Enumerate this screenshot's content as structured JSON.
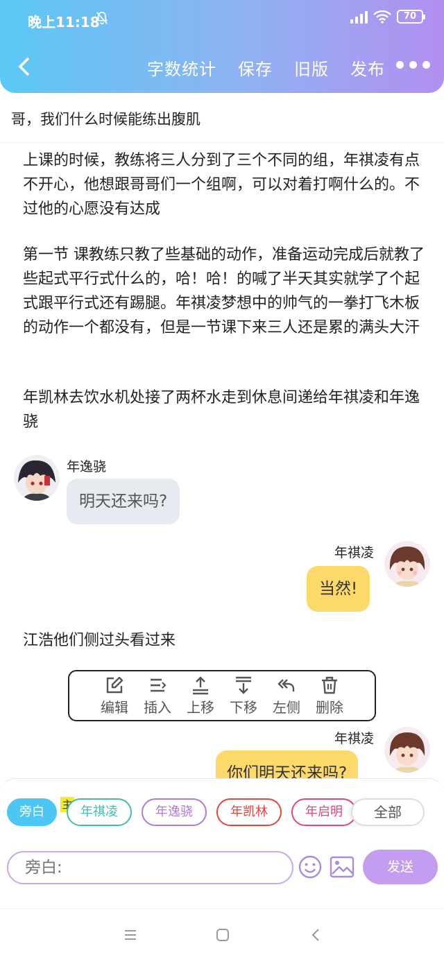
{
  "status_bar": {
    "time": "晚上11:18",
    "battery": "70"
  },
  "header": {
    "actions": [
      "字数统计",
      "保存",
      "旧版",
      "发布"
    ]
  },
  "story": {
    "title": "哥，我们什么时候能练出腹肌",
    "paragraphs": [
      "上课的时候，教练将三人分到了三个不同的组，年祺凌有点不开心，他想跟哥哥们一个组啊，可以对着打啊什么的。不过他的心愿没有达成",
      "第一节 课教练只教了些基础的动作，准备运动完成后就教了些起式平行式什么的，哈！哈！的喊了半天其实就学了个起式跟平行式还有踢腿。年祺凌梦想中的帅气的一拳打飞木板的动作一个都没有，但是一节课下来三人还是累的满头大汗",
      "年凯林去饮水机处接了两杯水走到休息间递给年祺凌和年逸骁",
      "江浩他们侧过头看过来"
    ],
    "messages": [
      {
        "name": "年逸骁",
        "text": "明天还来吗?"
      },
      {
        "name": "年祺凌",
        "text": "当然!"
      },
      {
        "name": "年祺凌",
        "text": "你们明天还来吗?"
      }
    ]
  },
  "toolbar": {
    "items": [
      {
        "label": "编辑",
        "icon": "edit-icon"
      },
      {
        "label": "插入",
        "icon": "insert-icon"
      },
      {
        "label": "上移",
        "icon": "move-up-icon"
      },
      {
        "label": "下移",
        "icon": "move-down-icon"
      },
      {
        "label": "左侧",
        "icon": "reply-left-icon"
      },
      {
        "label": "删除",
        "icon": "trash-icon"
      }
    ]
  },
  "characters": {
    "narrator": "旁白",
    "master_tag": "主",
    "list": [
      "年祺凌",
      "年逸骁",
      "年凯林",
      "年启明"
    ],
    "all": "全部"
  },
  "composer": {
    "placeholder": "旁白:",
    "send": "发送"
  },
  "colors": {
    "header_gradient": [
      "#5bc8f5",
      "#b28ff0"
    ],
    "chip_narrator": "#4cc6f3",
    "chip_qiling": "#3cbfa9",
    "chip_yixiao": "#b07ad8",
    "chip_kailin": "#e2453c",
    "chip_qiming": "#e2457a",
    "bubble_left": "#e6eaf1",
    "bubble_right": "#fcd96a",
    "send_button": "#c59df0"
  }
}
